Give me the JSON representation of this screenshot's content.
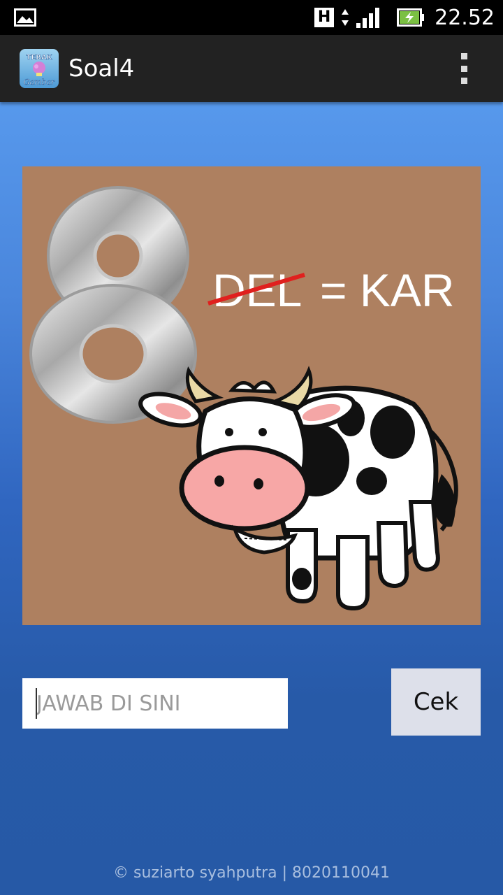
{
  "status_bar": {
    "network_badge": "H",
    "time": "22.52",
    "icons": [
      "gallery-notification-icon",
      "data-arrows-icon",
      "signal-icon",
      "battery-charging-icon"
    ]
  },
  "action_bar": {
    "app_icon_text_top": "TEBAK",
    "app_icon_text_bottom": "Gambar",
    "title": "Soal4",
    "overflow_icon": "overflow-menu-icon"
  },
  "puzzle": {
    "digit": "8",
    "struck_text": "DEL",
    "equals_text": "= KAR",
    "picture": "cow-illustration"
  },
  "answer": {
    "placeholder": "JAWAB DI SINI",
    "value": ""
  },
  "check_button": {
    "label": "Cek"
  },
  "footer": {
    "text": "© suziarto syahputra  |  8020110041"
  },
  "colors": {
    "puzzle_bg": "#ae8060",
    "strike": "#e0201e",
    "action_bar": "#222222",
    "button_bg": "#dde0ea"
  }
}
